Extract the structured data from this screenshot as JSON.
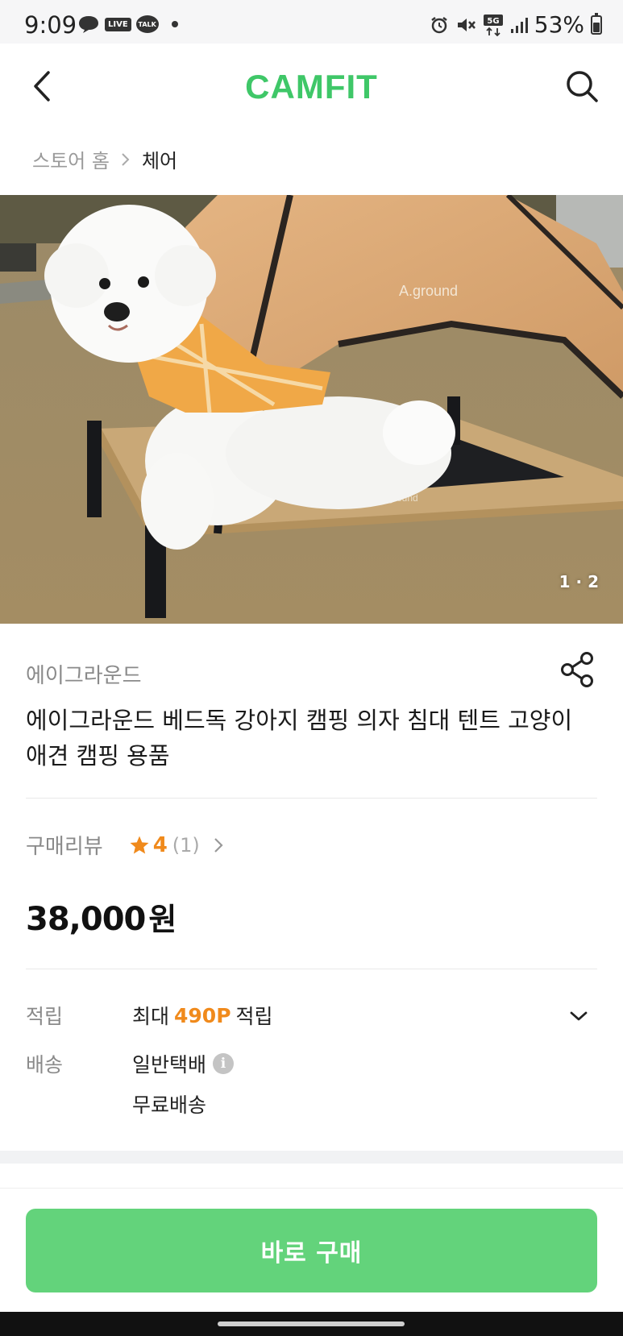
{
  "status_bar": {
    "time": "9:09",
    "live_badge": "LIVE",
    "talk_badge": "TALK",
    "network": "5G",
    "battery": "53%"
  },
  "header": {
    "logo": "CAMFIT",
    "back_icon": "chevron-left-icon",
    "search_icon": "search-icon"
  },
  "breadcrumb": {
    "home": "스토어 홈",
    "current": "체어"
  },
  "gallery": {
    "page_indicator": "1 · 2",
    "current_page": 1,
    "total_pages": 2
  },
  "product": {
    "brand": "에이그라운드",
    "title": "에이그라운드 베드독 강아지 캠핑 의자 침대 텐트 고양이 애견 캠핑 용품",
    "share_icon": "share-icon"
  },
  "review": {
    "label": "구매리뷰",
    "score": "4",
    "count": "(1)"
  },
  "price": {
    "amount": "38,000",
    "unit": "원"
  },
  "info": {
    "points_label": "적립",
    "points_prefix": "최대",
    "points_value": "490P",
    "points_suffix": "적립",
    "shipping_label": "배송",
    "shipping_method": "일반택배",
    "shipping_fee": "무료배송"
  },
  "cta": {
    "buy_label": "바로 구매"
  },
  "colors": {
    "brand_green": "#3fc768",
    "button_green": "#63d37b",
    "accent_orange": "#f08a1c"
  }
}
